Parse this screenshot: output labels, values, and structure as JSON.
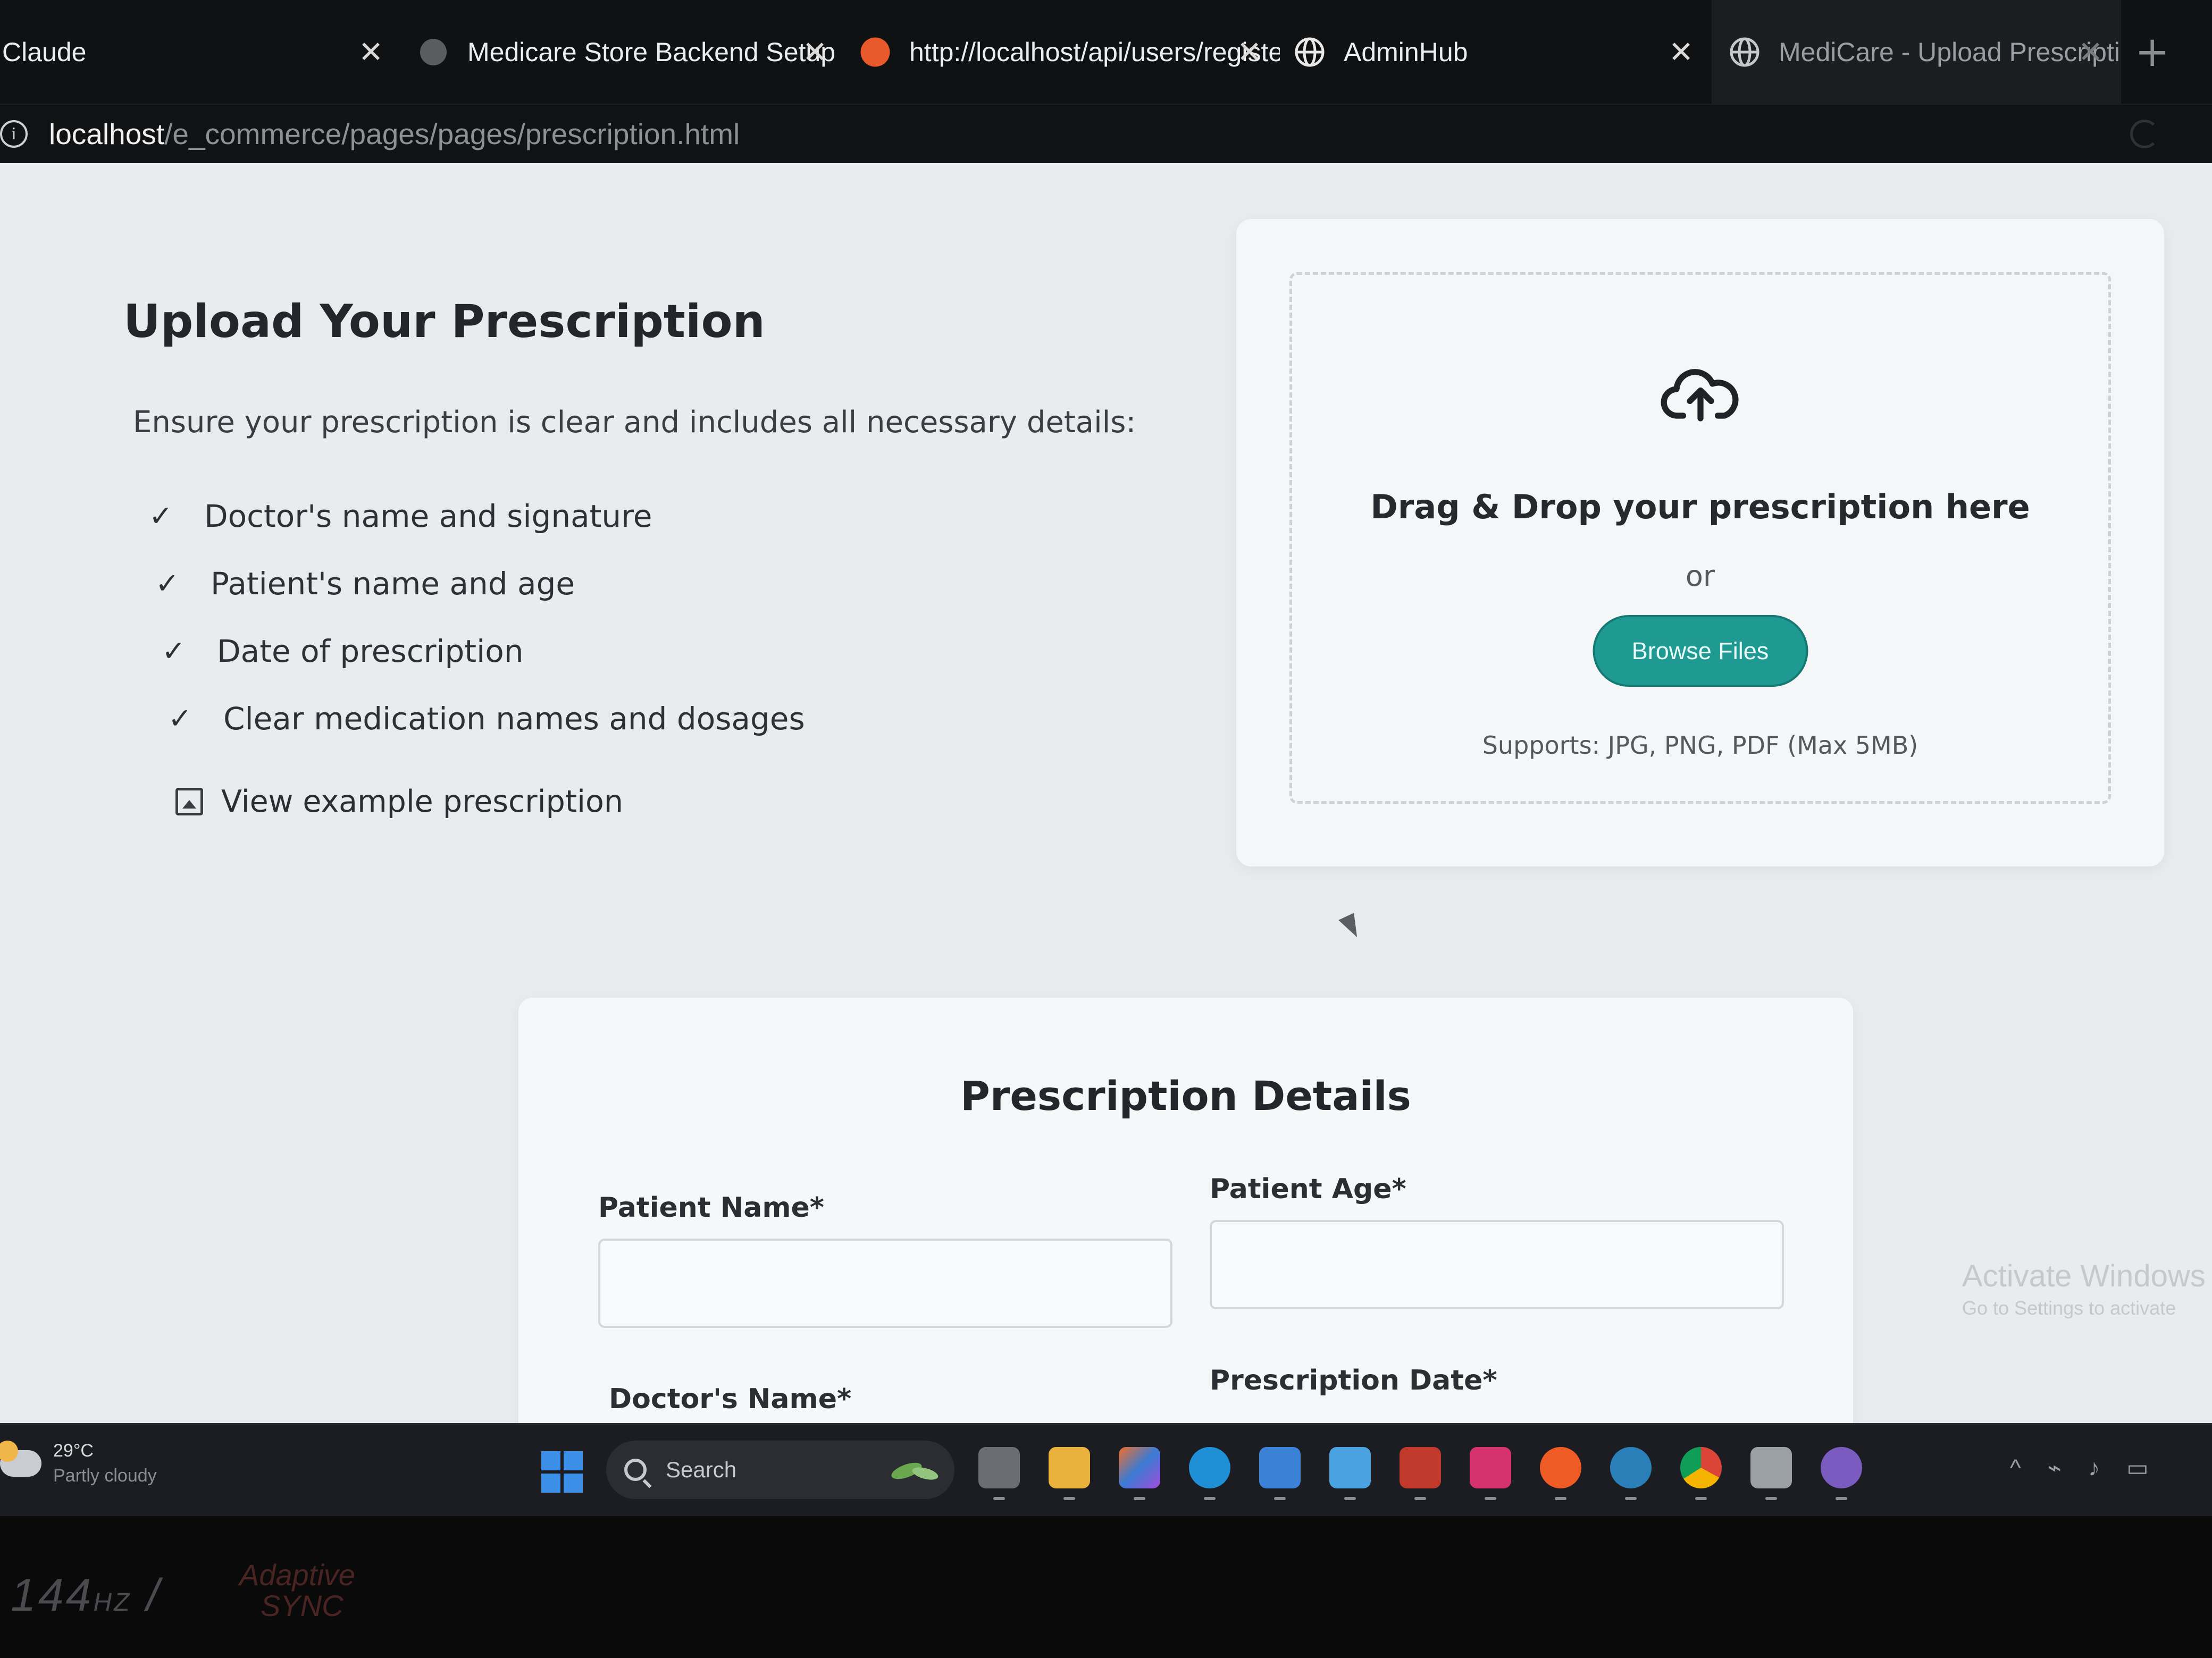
{
  "browser": {
    "tabs": [
      {
        "label": "Claude",
        "close": "✕"
      },
      {
        "label": "Medicare Store Backend Setup",
        "close": "✕"
      },
      {
        "label": "http://localhost/api/users/registe",
        "close": "✕"
      },
      {
        "label": "AdminHub",
        "close": "✕"
      },
      {
        "label": "MediCare - Upload Prescription",
        "close": "✕"
      }
    ],
    "new_tab": "+",
    "url_host": "localhost",
    "url_path": "/e_commerce/pages/pages/prescription.html"
  },
  "upload": {
    "heading": "Upload Your Prescription",
    "subtitle": "Ensure your prescription is clear and includes all necessary details:",
    "requirements": [
      "Doctor's name and signature",
      "Patient's name and age",
      "Date of prescription",
      "Clear medication names and dosages"
    ],
    "check_mark": "✓",
    "view_example": "View example prescription"
  },
  "dropzone": {
    "title": "Drag & Drop your prescription here",
    "or": "or",
    "browse_label": "Browse Files",
    "supports": "Supports: JPG, PNG, PDF (Max 5MB)"
  },
  "details": {
    "title": "Prescription Details",
    "patient_name_label": "Patient Name*",
    "patient_age_label": "Patient Age*",
    "doctor_name_label": "Doctor's Name*",
    "prescription_date_label": "Prescription Date*",
    "patient_name_value": "",
    "patient_age_value": ""
  },
  "watermark": {
    "line1": "Activate Windows",
    "line2": "Go to Settings to activate"
  },
  "taskbar": {
    "temperature": "29°C",
    "condition": "Partly cloudy",
    "search_label": "Search",
    "apps": [
      "task-view-icon",
      "file-explorer-icon",
      "copilot-icon",
      "edge-icon",
      "store-icon",
      "notepad-icon",
      "shield-app-icon",
      "jetbrains-icon",
      "postman-icon",
      "edge-dev-icon",
      "chrome-icon",
      "snipping-tool-icon",
      "github-icon"
    ],
    "tray": [
      "^",
      "⌁",
      "♪",
      "▭"
    ]
  },
  "bezel": {
    "refresh_rate": "144",
    "refresh_unit": "HZ",
    "sync_line1": "Adaptive",
    "sync_line2": "SYNC"
  },
  "colors": {
    "accent": "#1e9a93",
    "page_bg": "#e9ecee",
    "card_bg": "#f5f6f7"
  }
}
